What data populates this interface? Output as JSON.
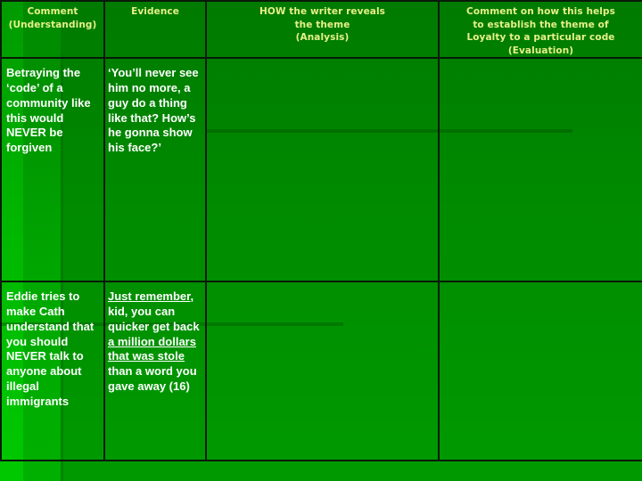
{
  "headers": [
    {
      "line1": "Comment",
      "line2": "(Understanding)"
    },
    {
      "line1": "Evidence"
    },
    {
      "line1": "HOW the writer reveals",
      "line2": "the theme",
      "line3": "(Analysis)"
    },
    {
      "line1": "Comment on how this helps",
      "line2": "to establish the theme of",
      "line3": "Loyalty to a particular code",
      "line4": "(Evaluation)"
    }
  ],
  "rows": [
    {
      "comment": "Betraying the ‘code’ of a community like this would NEVER be forgiven",
      "evidence": "‘You’ll never see him no more, a guy do a thing like that?  How’s he gonna show his face?’",
      "analysis": "",
      "evaluation": ""
    },
    {
      "comment": "Eddie tries to make Cath understand that you should NEVER talk to anyone about illegal immigrants",
      "evidence_parts": {
        "p1_underlined": "Just remember",
        "p2": ", kid, you can quicker get back ",
        "p3_underlined": "a million dollars that was stole",
        "p4": " than a word you gave away (16)"
      },
      "analysis": "",
      "evaluation": ""
    }
  ]
}
